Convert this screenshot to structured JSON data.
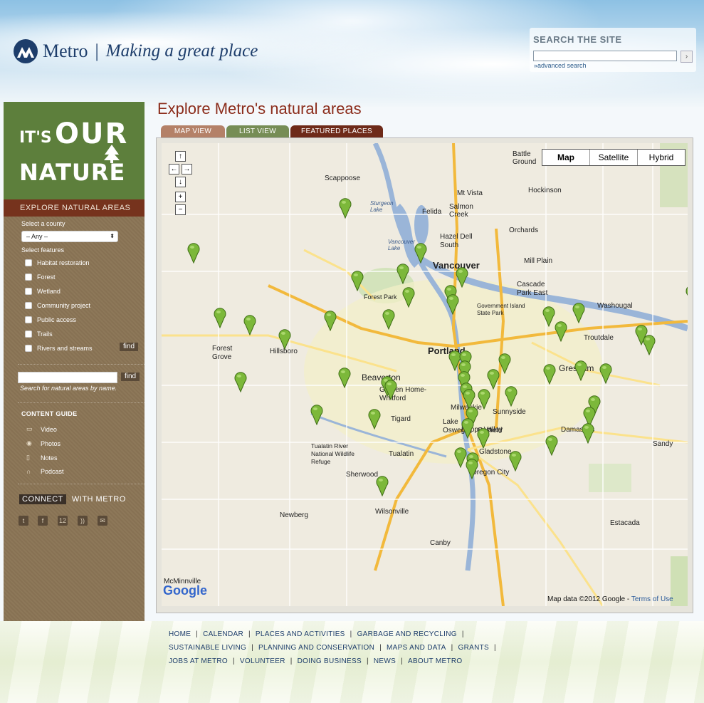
{
  "header": {
    "logo_text": "Metro",
    "separator": "|",
    "tagline": "Making a great place",
    "search_title": "SEARCH THE SITE",
    "search_go": "›",
    "advanced_search": "»advanced search"
  },
  "sidebar": {
    "badge": {
      "its": "IT'S",
      "our": "OUR",
      "nature": "NATURE"
    },
    "explore_header": "EXPLORE NATURAL AREAS",
    "select_county_label": "Select a county",
    "county_value": "– Any –",
    "select_features_label": "Select features",
    "features": [
      "Habitat restoration",
      "Forest",
      "Wetland",
      "Community project",
      "Public access",
      "Trails",
      "Rivers and streams"
    ],
    "find_label": "find",
    "search_note": "Search for natural areas by name.",
    "content_guide_title": "CONTENT GUIDE",
    "content_guide": [
      {
        "label": "Video",
        "icon": "video-icon",
        "glyph": "▭"
      },
      {
        "label": "Photos",
        "icon": "camera-icon",
        "glyph": "◉"
      },
      {
        "label": "Notes",
        "icon": "note-icon",
        "glyph": "▯"
      },
      {
        "label": "Podcast",
        "icon": "headphones-icon",
        "glyph": "∩"
      }
    ],
    "connect_a": "CONNECT",
    "connect_b": "WITH METRO",
    "social": [
      {
        "icon": "twitter-icon",
        "glyph": "t"
      },
      {
        "icon": "facebook-icon",
        "glyph": "f"
      },
      {
        "icon": "calendar-icon",
        "glyph": "12"
      },
      {
        "icon": "rss-icon",
        "glyph": "))"
      },
      {
        "icon": "email-icon",
        "glyph": "✉"
      }
    ]
  },
  "main": {
    "title": "Explore Metro's natural areas",
    "tabs": [
      {
        "label": "MAP VIEW",
        "color": "#b48168"
      },
      {
        "label": "LIST VIEW",
        "color": "#768d55"
      },
      {
        "label": "FEATURED PLACES",
        "color": "#6e2a19"
      }
    ]
  },
  "map": {
    "map_types": [
      "Map",
      "Satellite",
      "Hybrid"
    ],
    "selected_map_type": "Map",
    "pan": {
      "up": "↑",
      "left": "←",
      "right": "→",
      "down": "↓",
      "zoom_in": "+",
      "zoom_out": "−"
    },
    "labels": [
      "Battle Ground",
      "Scappoose",
      "Hockinson",
      "Mt Vista",
      "Salmon Creek",
      "Felida",
      "Orchards",
      "Hazel Dell South",
      "Vancouver",
      "Mill Plain",
      "Cascade Park East",
      "Washougal",
      "Troutdale",
      "Portland",
      "Gresham",
      "Beaverton",
      "Forest Grove",
      "Hillsboro",
      "Garden Home-Whitford",
      "Tigard",
      "Lake Oswego",
      "Milwaukie",
      "Happy Valley",
      "Damascus",
      "Sandy",
      "Tualatin",
      "Sherwood",
      "Gladstone",
      "Oregon City",
      "Newberg",
      "Wilsonville",
      "Canby",
      "Estacada",
      "McMinnville",
      "Forest Park",
      "Sturgeon Lake",
      "Vancouver Lake",
      "Government Island State Park",
      "Tualatin River National Wildlife Refuge",
      "Sunnyside",
      "Oatfield"
    ],
    "logo": "Google",
    "credit": "Map data ©2012 Google - ",
    "terms": "Terms of Use"
  },
  "footer": {
    "row1": [
      "HOME",
      "CALENDAR",
      "PLACES AND ACTIVITIES",
      "GARBAGE AND RECYCLING"
    ],
    "row2": [
      "SUSTAINABLE LIVING",
      "PLANNING AND CONSERVATION",
      "MAPS AND DATA",
      "GRANTS"
    ],
    "row3": [
      "JOBS AT METRO",
      "VOLUNTEER",
      "DOING BUSINESS",
      "NEWS",
      "ABOUT METRO"
    ]
  }
}
